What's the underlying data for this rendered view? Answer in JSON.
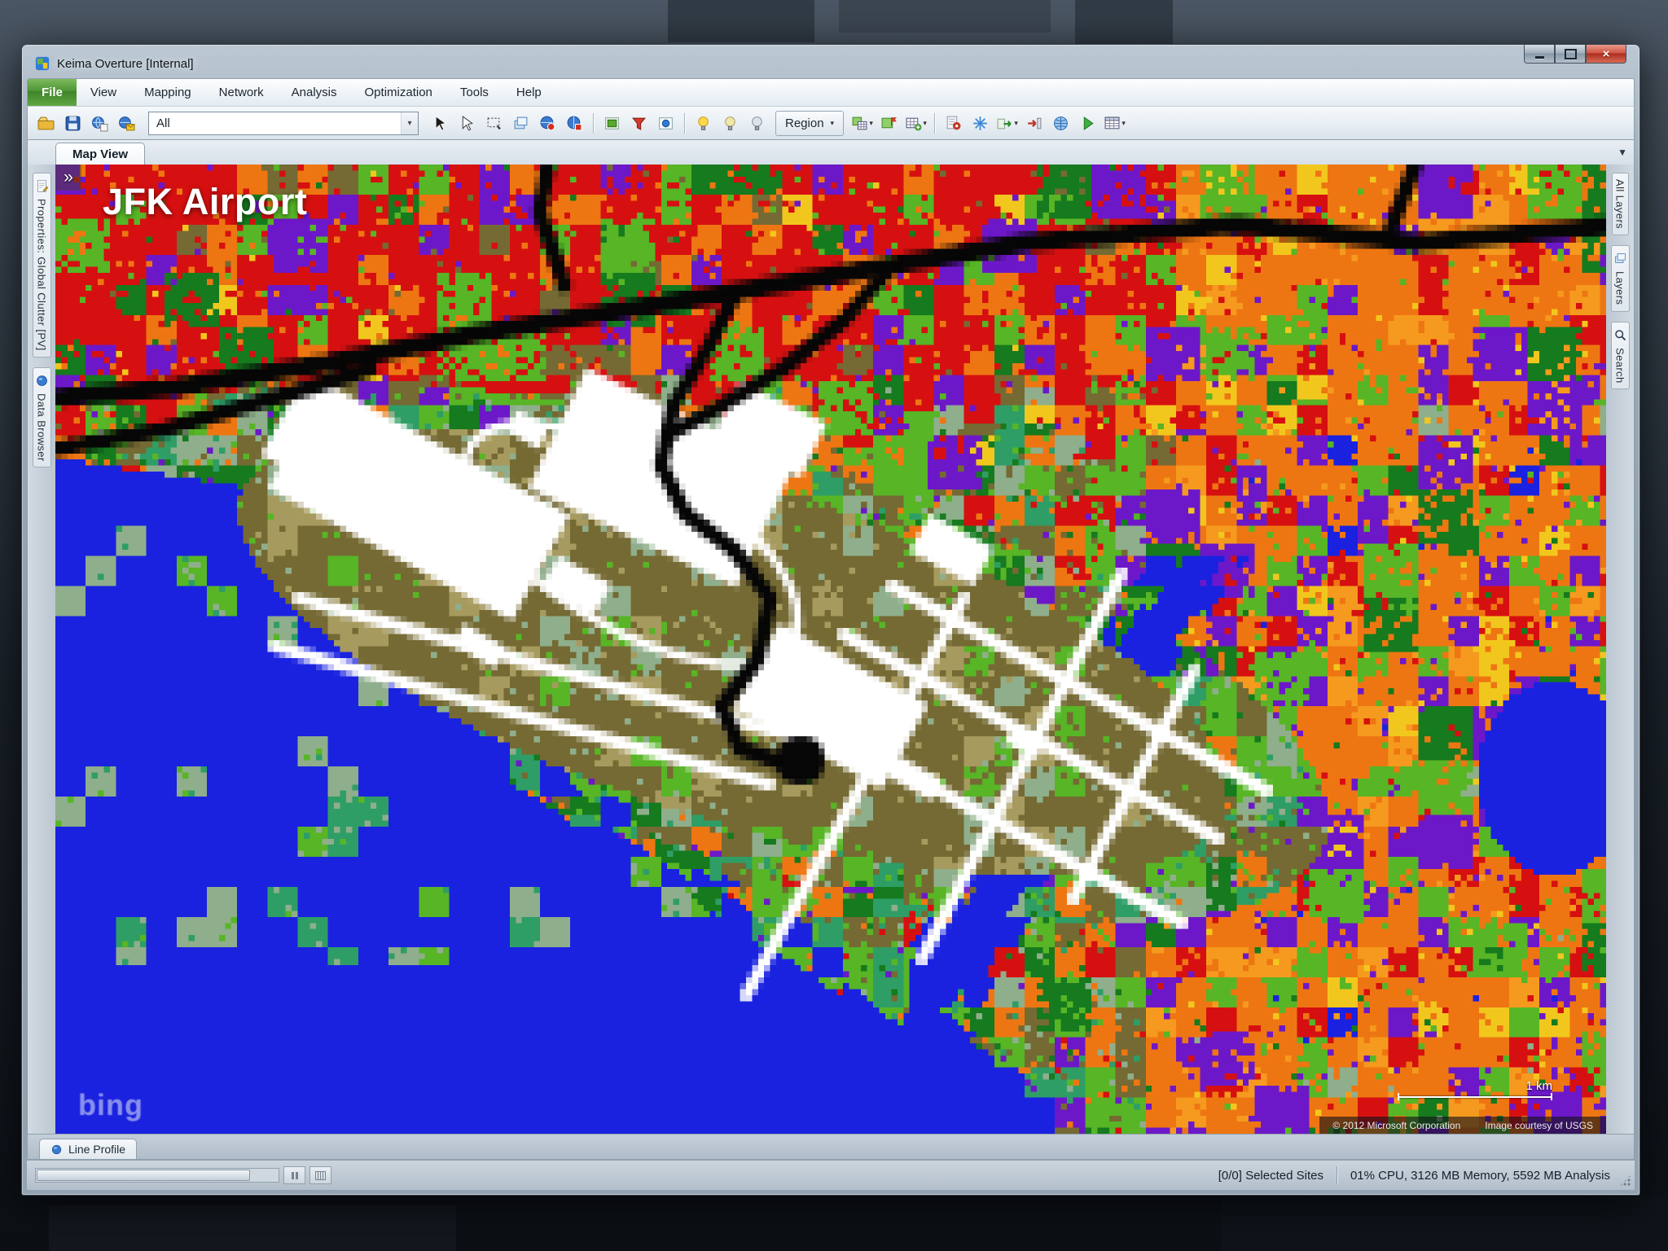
{
  "window": {
    "title": "Keima Overture [Internal]"
  },
  "menu": {
    "items": [
      {
        "label": "File",
        "accent": true
      },
      {
        "label": "View"
      },
      {
        "label": "Mapping"
      },
      {
        "label": "Network"
      },
      {
        "label": "Analysis"
      },
      {
        "label": "Optimization"
      },
      {
        "label": "Tools"
      },
      {
        "label": "Help"
      }
    ]
  },
  "toolbar": {
    "items": [
      {
        "name": "open-button",
        "icon": "folder"
      },
      {
        "name": "save-button",
        "icon": "floppy"
      },
      {
        "name": "map-document-button",
        "icon": "globe-doc"
      },
      {
        "name": "map-export-button",
        "icon": "globe-mail"
      },
      {
        "type": "combo",
        "name": "layer-filter-combo",
        "value": "All"
      },
      {
        "name": "pointer-tool-button",
        "icon": "cursor-dark"
      },
      {
        "name": "pan-tool-button",
        "icon": "cursor-white"
      },
      {
        "name": "marquee-select-button",
        "icon": "marquee"
      },
      {
        "name": "duplicate-view-button",
        "icon": "layers"
      },
      {
        "name": "sites-globe-button",
        "icon": "globe-red"
      },
      {
        "name": "network-globe-button",
        "icon": "globe-red2"
      },
      {
        "sep": true
      },
      {
        "name": "clutter-toggle-button",
        "icon": "toggle-green"
      },
      {
        "name": "filter-toggle-button",
        "icon": "funnel-red"
      },
      {
        "name": "points-toggle-button",
        "icon": "toggle-blue"
      },
      {
        "sep": true
      },
      {
        "name": "bulb-on-button",
        "icon": "bulb-on"
      },
      {
        "name": "bulb-mid-button",
        "icon": "bulb-mid"
      },
      {
        "name": "bulb-off-button",
        "icon": "bulb-off"
      },
      {
        "type": "dropdown-button",
        "name": "region-dropdown",
        "label": "Region"
      },
      {
        "name": "map-table-button",
        "icon": "map-table",
        "dropdown": true
      },
      {
        "name": "map-flag-button",
        "icon": "map-flag"
      },
      {
        "name": "table-views-button",
        "icon": "table-add",
        "dropdown": true
      },
      {
        "sep": true
      },
      {
        "name": "report-settings-button",
        "icon": "gear-doc"
      },
      {
        "name": "snowflake-button",
        "icon": "snowflake"
      },
      {
        "name": "export-run-button",
        "icon": "export-green",
        "dropdown": true
      },
      {
        "name": "import-button",
        "icon": "import-red"
      },
      {
        "name": "web-map-button",
        "icon": "globe-blue"
      },
      {
        "name": "run-analysis-button",
        "icon": "play-green"
      },
      {
        "name": "results-grid-button",
        "icon": "grid",
        "dropdown": true
      }
    ]
  },
  "tabrow": {
    "map_view": "Map View",
    "chevron": "▼"
  },
  "left_dock": {
    "items": [
      {
        "label": "Properties: Global Clutter [PV]",
        "icon": "props"
      },
      {
        "label": "Data Browser",
        "icon": "sphere"
      }
    ]
  },
  "right_dock": {
    "items": [
      {
        "label": "All Layers"
      },
      {
        "label": "Layers",
        "icon": "layers"
      },
      {
        "label": "Search",
        "icon": "search"
      }
    ]
  },
  "map": {
    "title_label": "JFK Airport",
    "collapse_glyph": "»",
    "watermark": "bing",
    "scale_label": "1 km",
    "attribution_copyright": "© 2012 Microsoft Corporation",
    "attribution_imagery": "Image courtesy of USGS",
    "palette": {
      "water": "#1a22e0",
      "red": "#d61010",
      "orange": "#ee7612",
      "orange2": "#f59a1e",
      "yellow": "#f2c71d",
      "purple": "#6d18c8",
      "green": "#57b526",
      "dkgreen": "#167a1e",
      "teal": "#2e9e66",
      "gray_green": "#8fae8b",
      "olive": "#756a33",
      "tan": "#a79a5e",
      "white": "#ffffff",
      "black": "#060606"
    }
  },
  "bottom_tabs": {
    "line_profile": "Line Profile"
  },
  "status": {
    "selected_sites": "[0/0] Selected Sites",
    "performance": "01% CPU, 3126 MB Memory, 5592 MB Analysis"
  }
}
